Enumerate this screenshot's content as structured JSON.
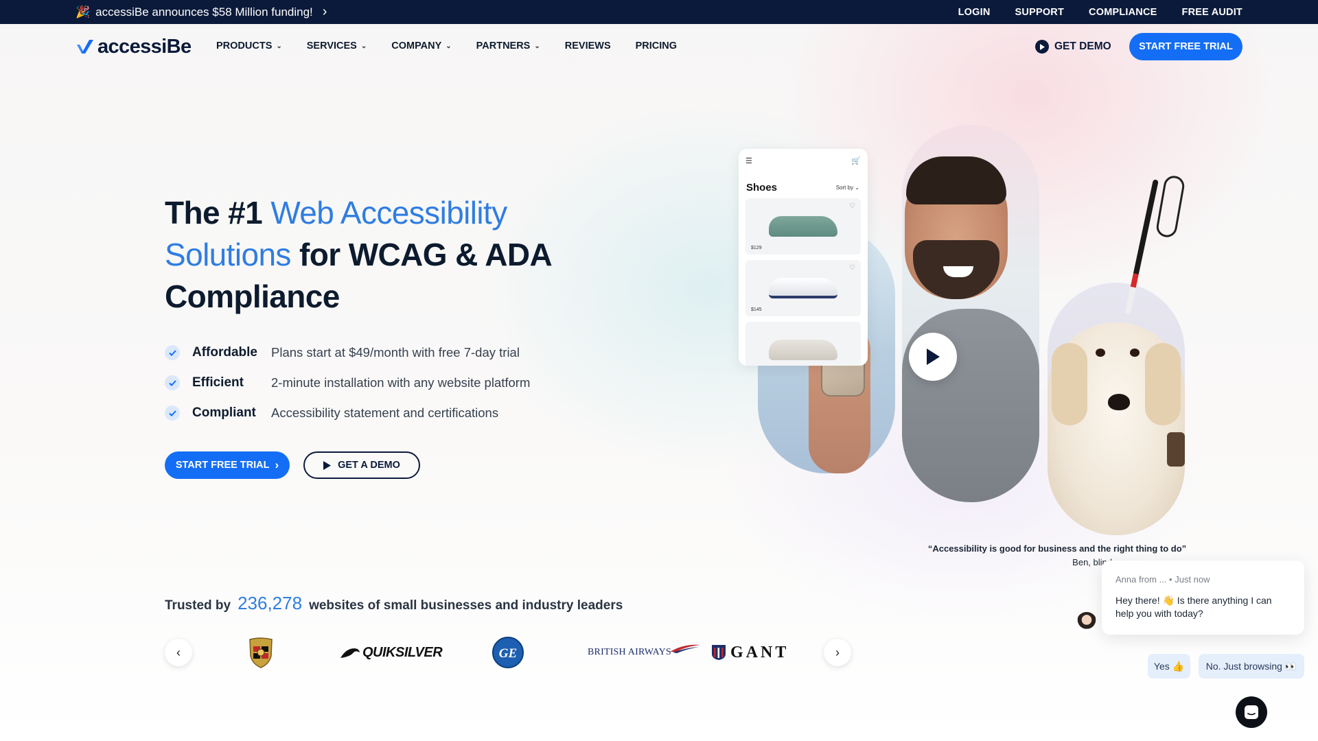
{
  "topbar": {
    "announcement": "accessiBe announces $58 Million funding!",
    "announcement_icon": "party-popper-icon",
    "links": [
      "LOGIN",
      "SUPPORT",
      "COMPLIANCE",
      "FREE AUDIT"
    ]
  },
  "nav": {
    "logo_text": "accessiBe",
    "items": [
      {
        "label": "PRODUCTS",
        "dropdown": true
      },
      {
        "label": "SERVICES",
        "dropdown": true
      },
      {
        "label": "COMPANY",
        "dropdown": true
      },
      {
        "label": "PARTNERS",
        "dropdown": true
      },
      {
        "label": "REVIEWS",
        "dropdown": false
      },
      {
        "label": "PRICING",
        "dropdown": false
      }
    ],
    "get_demo": "GET DEMO",
    "start_trial": "START FREE TRIAL"
  },
  "hero": {
    "title_part1": "The #1 ",
    "title_highlight": "Web Accessibility Solutions",
    "title_part2": " for WCAG & ADA Compliance",
    "features": [
      {
        "name": "Affordable",
        "desc": "Plans start at $49/month with free 7-day trial"
      },
      {
        "name": "Efficient",
        "desc": "2-minute installation with any website platform"
      },
      {
        "name": "Compliant",
        "desc": "Accessibility statement and certifications"
      }
    ],
    "cta_primary": "START FREE TRIAL",
    "cta_secondary": "GET A DEMO"
  },
  "shop_card": {
    "title": "Shoes",
    "sort": "Sort by",
    "prices": [
      "$129",
      "$145"
    ]
  },
  "quote": {
    "text": "“Accessibility is good for business and the right thing to do”",
    "author": "Ben, blind"
  },
  "trusted": {
    "prefix": "Trusted by",
    "count": "236,278",
    "suffix": "websites of small businesses and industry leaders",
    "logos": [
      "porsche-logo",
      "quiksilver-logo",
      "ge-logo",
      "british-airways-logo",
      "gant-logo"
    ],
    "quiksilver": "QUIKSILVER",
    "british_airways": "BRITISH AIRWAYS",
    "gant": "GANT",
    "ge": "GE"
  },
  "chat": {
    "agent": "Anna from ...",
    "time": "• Just now",
    "message": "Hey there! 👋 Is there anything I can help you with today?",
    "reply_yes": "Yes 👍",
    "reply_no": "No. Just browsing 👀"
  },
  "colors": {
    "brand_blue": "#146ef5",
    "highlight_blue": "#2f7de1",
    "navy": "#0b1a3a"
  }
}
